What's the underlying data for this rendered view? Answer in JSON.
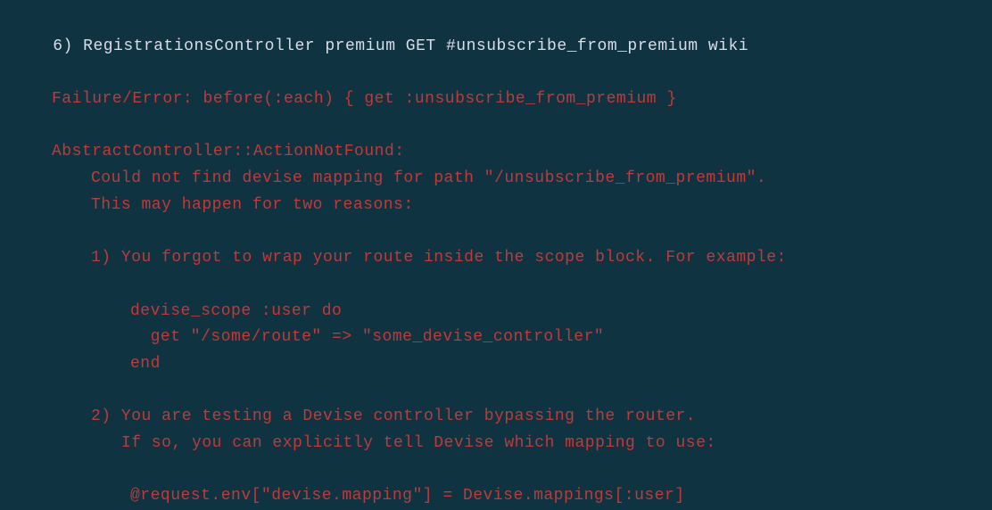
{
  "test": {
    "number": "6)",
    "title": "RegistrationsController premium GET #unsubscribe_from_premium wiki",
    "failure_line": "Failure/Error: before(:each) { get :unsubscribe_from_premium }",
    "error_class": "AbstractController::ActionNotFound:",
    "messages": {
      "m1": "Could not find devise mapping for path \"/unsubscribe_from_premium\".",
      "m2": "This may happen for two reasons:",
      "m3": "1) You forgot to wrap your route inside the scope block. For example:",
      "m4": "devise_scope :user do",
      "m5": "  get \"/some/route\" => \"some_devise_controller\"",
      "m6": "end",
      "m7": "2) You are testing a Devise controller bypassing the router.",
      "m8": "   If so, you can explicitly tell Devise which mapping to use:",
      "m9": "@request.env[\"devise.mapping\"] = Devise.mappings[:user]"
    }
  }
}
